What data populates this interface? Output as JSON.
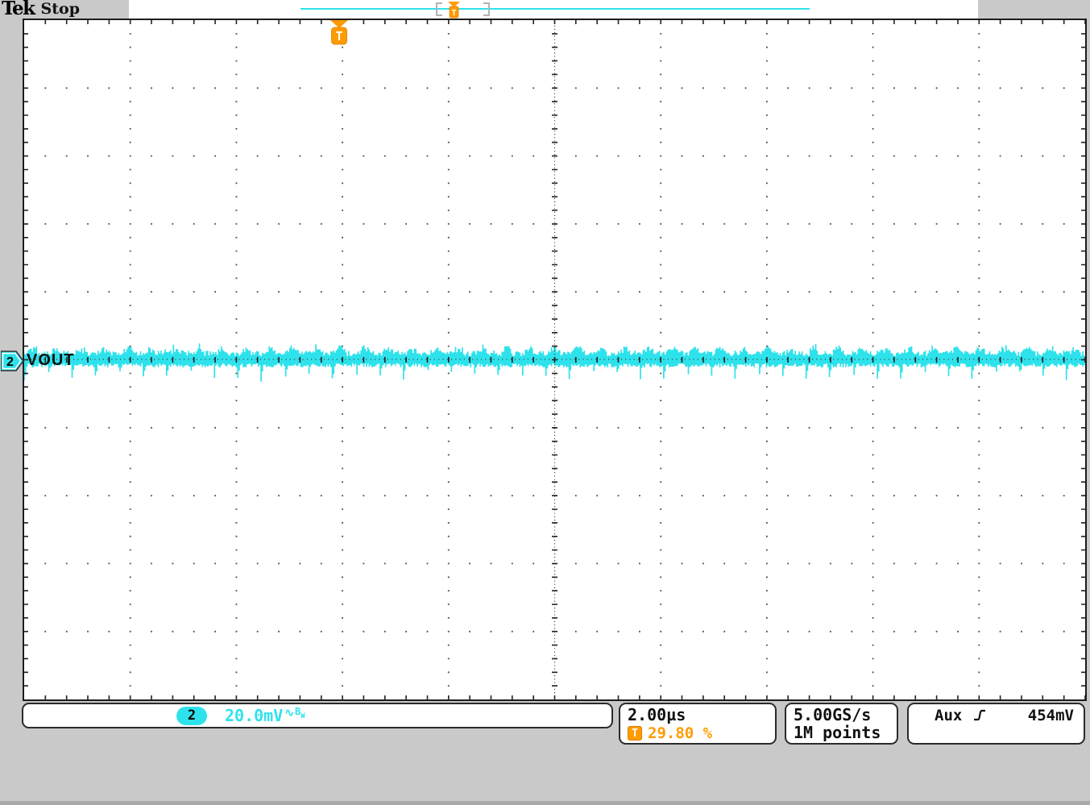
{
  "header": {
    "logo": "Tek",
    "acquisition_status": "Stop"
  },
  "channel2": {
    "number": "2",
    "label": "VOUT",
    "scale": "20.0mV",
    "coupling_symbol": "∿",
    "bandwidth_main": "B",
    "bandwidth_sub": "W",
    "color": "#2ee2ec"
  },
  "horizontal": {
    "timebase": "2.00µs",
    "sample_rate": "5.00GS/s",
    "record_length": "1M points"
  },
  "trigger": {
    "flag_letter": "T",
    "position": "29.80 %",
    "source": "Aux",
    "slope": "rising-edge",
    "level": "454mV",
    "color": "#ff9c00"
  },
  "waveform": {
    "name": "VOUT",
    "description": "AC-coupled switching ripple noise band centered on 0 divisions, ~0.5 div peak-to-peak",
    "grid": "10x10 divisions"
  }
}
